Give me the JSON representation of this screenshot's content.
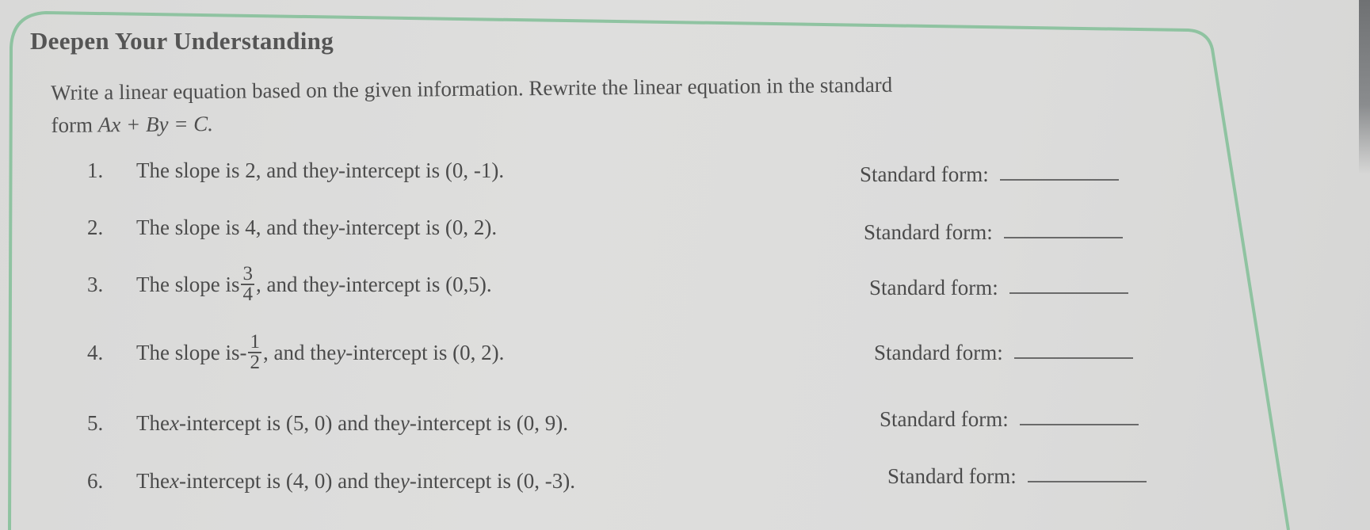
{
  "worksheet": {
    "title": "Deepen Your Understanding",
    "instructions": {
      "line1": "Write a linear equation based on the given information. Rewrite the linear equation in the standard",
      "line2_prefix": "form ",
      "line2_math": "Ax + By = C."
    },
    "answer_label": "Standard form:",
    "items": [
      {
        "number": "1.",
        "pre": "The slope is 2, and the ",
        "var": "y",
        "post": "-intercept is (0, -1)."
      },
      {
        "number": "2.",
        "pre": "The slope is 4, and the ",
        "var": "y",
        "post": "-intercept is (0, 2)."
      },
      {
        "number": "3.",
        "pre": "The slope is ",
        "frac_sign": "",
        "frac_num": "3",
        "frac_den": "4",
        "mid": ", and the ",
        "var": "y",
        "post": "-intercept is (0,5)."
      },
      {
        "number": "4.",
        "pre": "The slope is ",
        "frac_sign": "-",
        "frac_num": "1",
        "frac_den": "2",
        "mid": ", and the ",
        "var": "y",
        "post": "-intercept is (0, 2)."
      },
      {
        "number": "5.",
        "pre": "The ",
        "var1": "x",
        "mid": "-intercept is (5, 0) and the ",
        "var": "y",
        "post": "-intercept is (0, 9)."
      },
      {
        "number": "6.",
        "pre": "The ",
        "var1": "x",
        "mid": "-intercept is (4, 0) and the ",
        "var": "y",
        "post": "-intercept is (0, -3)."
      }
    ],
    "colors": {
      "frame_border": "#8fc3a1",
      "text": "#4b4b4b",
      "paper": "#dcdcdb"
    }
  }
}
